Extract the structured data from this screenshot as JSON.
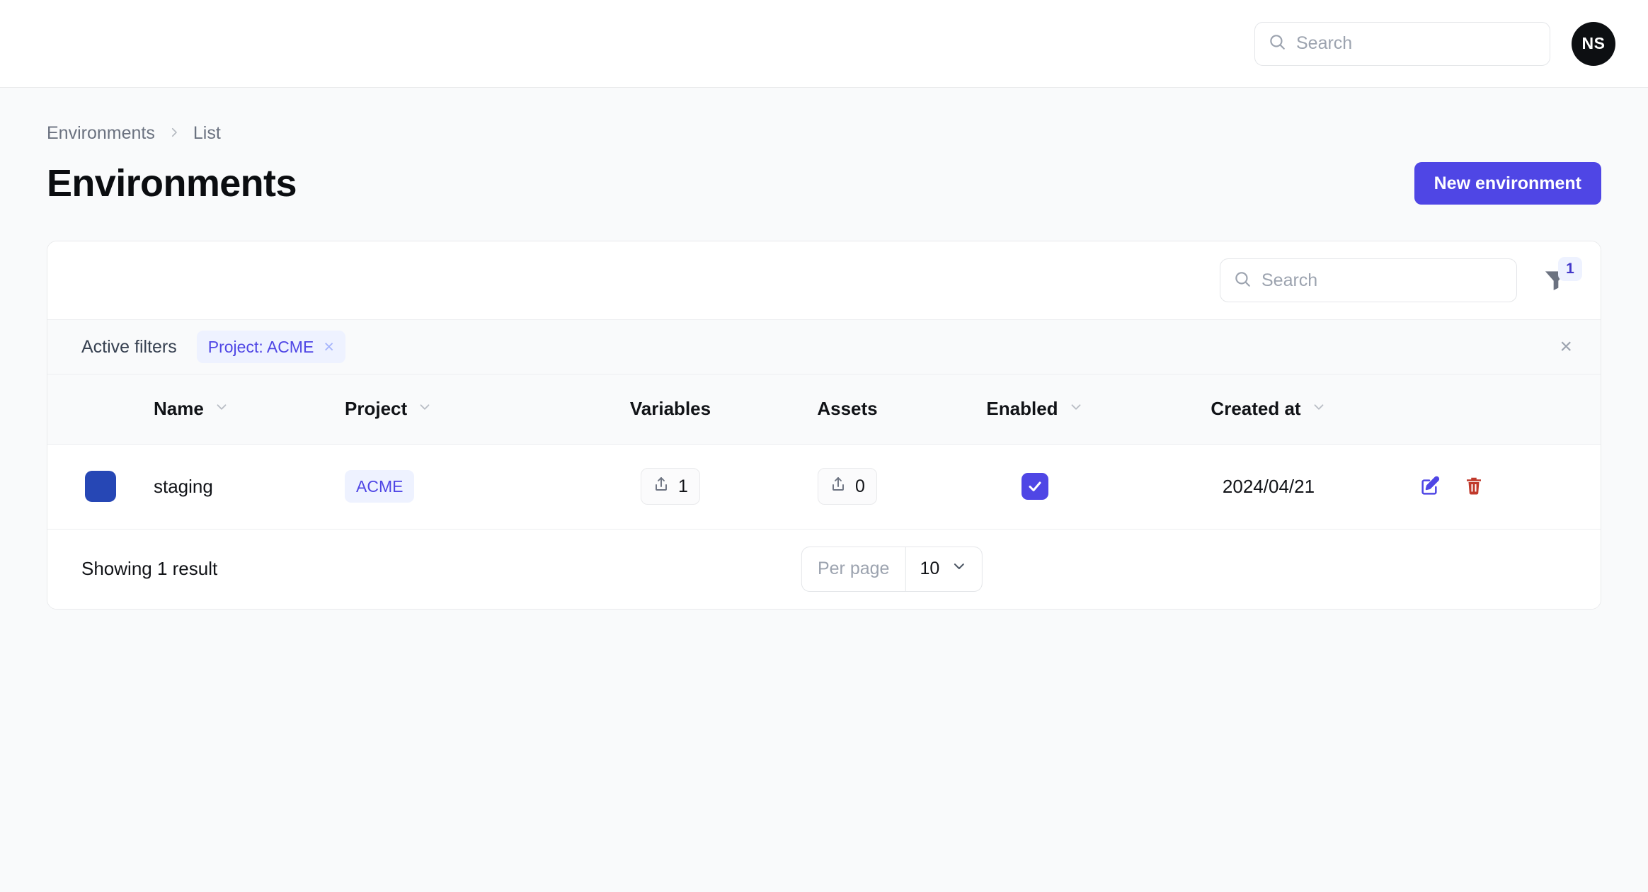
{
  "topbar": {
    "search_placeholder": "Search",
    "avatar_initials": "NS"
  },
  "breadcrumb": {
    "root": "Environments",
    "separator": "›",
    "current": "List"
  },
  "header": {
    "title": "Environments",
    "new_button": "New environment"
  },
  "toolbar": {
    "search_placeholder": "Search",
    "filter_count": "1"
  },
  "filters": {
    "label": "Active filters",
    "chips": [
      {
        "text": "Project: ACME",
        "remove": "×"
      }
    ],
    "clear_all": "×"
  },
  "table": {
    "columns": [
      {
        "label": "",
        "sortable": false
      },
      {
        "label": "Name",
        "sortable": true
      },
      {
        "label": "Project",
        "sortable": true
      },
      {
        "label": "Variables",
        "sortable": false
      },
      {
        "label": "Assets",
        "sortable": false
      },
      {
        "label": "Enabled",
        "sortable": true
      },
      {
        "label": "Created at",
        "sortable": true
      },
      {
        "label": "",
        "sortable": false
      }
    ],
    "rows": [
      {
        "color": "#2647b5",
        "name": "staging",
        "project": "ACME",
        "variables": "1",
        "assets": "0",
        "enabled": true,
        "created_at": "2024/04/21"
      }
    ]
  },
  "footer": {
    "result_text": "Showing 1 result",
    "per_page_label": "Per page",
    "per_page_value": "10"
  },
  "colors": {
    "accent": "#4f46e5",
    "accent_soft": "#eef2ff",
    "danger": "#c0392b",
    "page_bg": "#f9fafb",
    "swatch": "#2647b5"
  }
}
